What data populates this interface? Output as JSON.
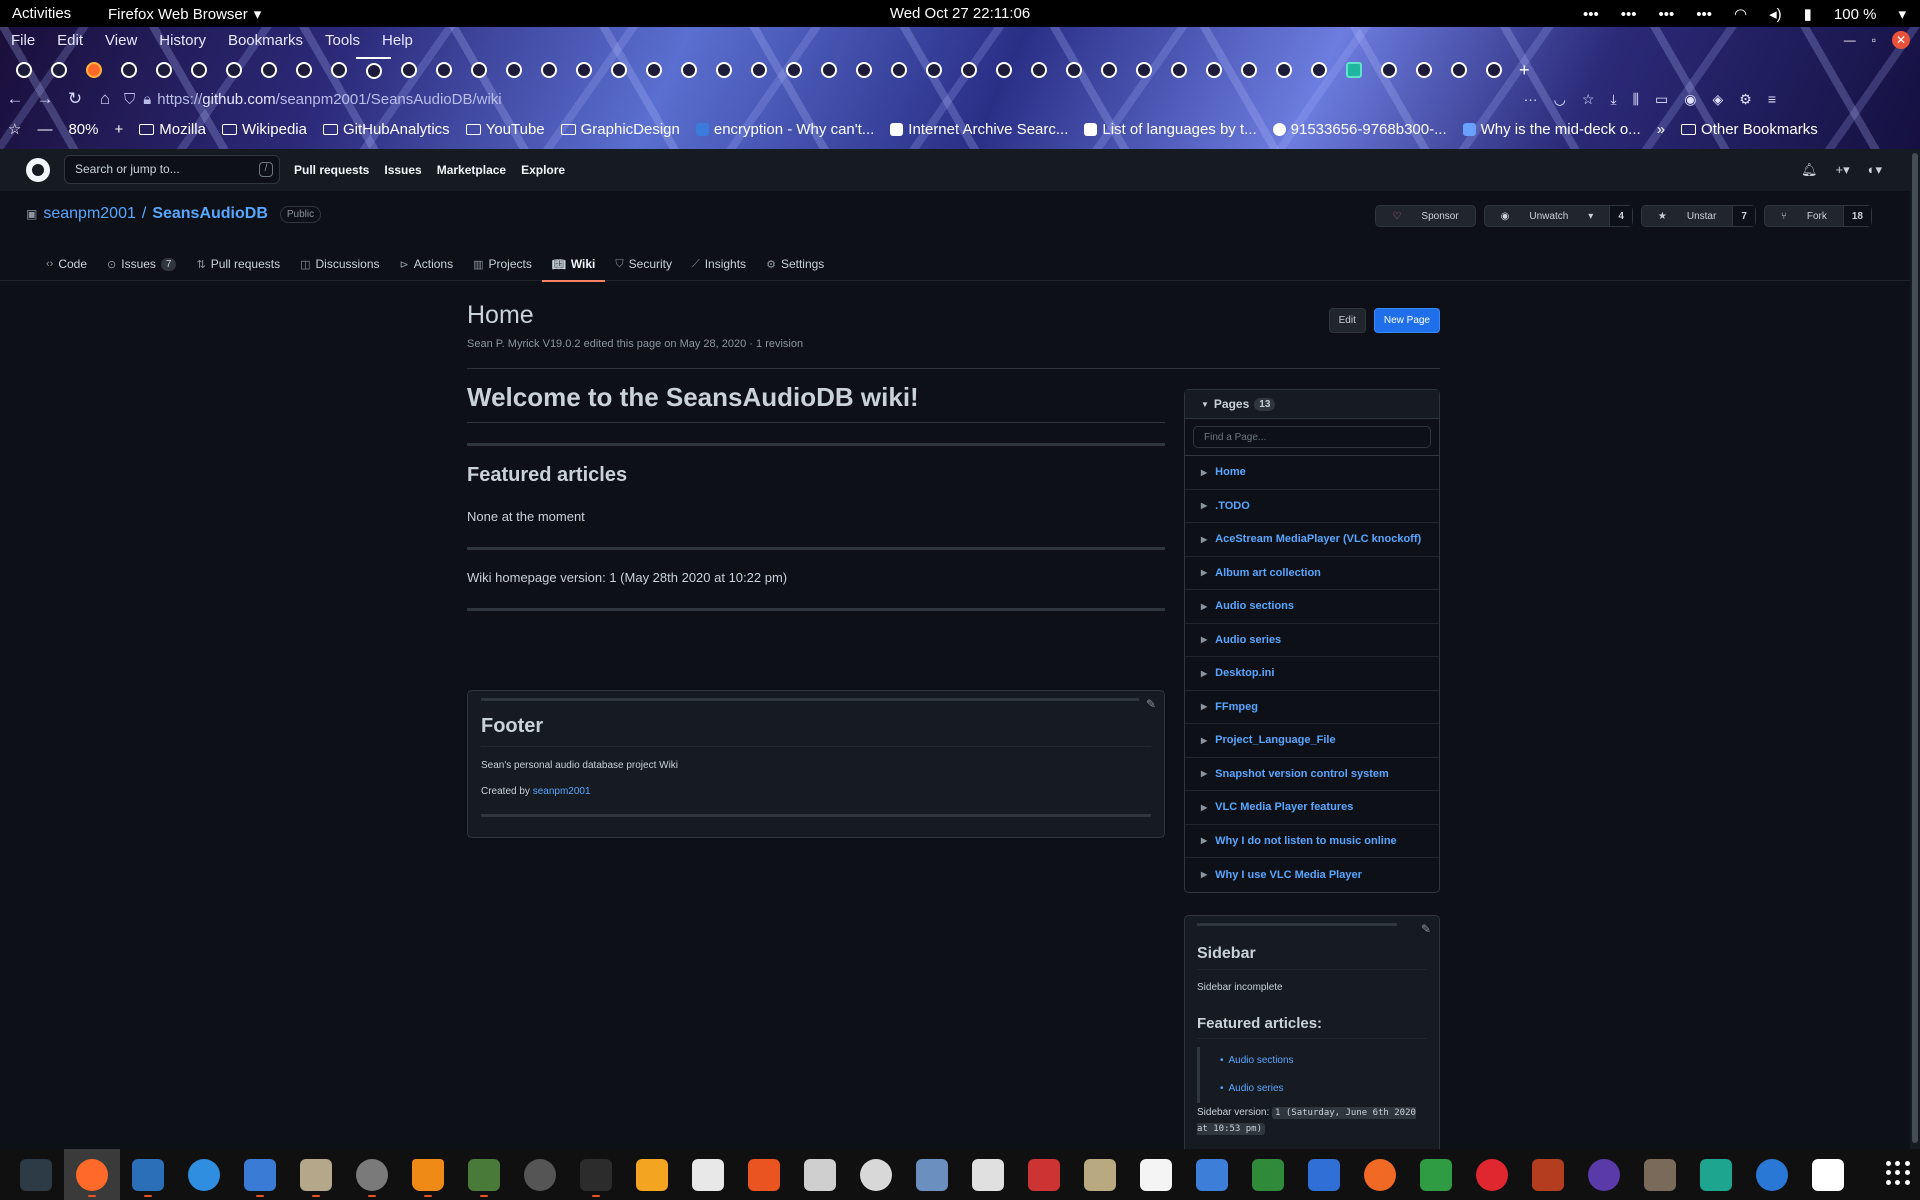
{
  "system": {
    "activities": "Activities",
    "app_name": "Firefox Web Browser",
    "clock": "Wed Oct 27  22:11:06",
    "battery": "100 %"
  },
  "firefox": {
    "menu": [
      "File",
      "Edit",
      "View",
      "History",
      "Bookmarks",
      "Tools",
      "Help"
    ],
    "url_prefix": "https://",
    "url_host": "github.com",
    "url_path": "/seanpm2001/SeansAudioDB/wiki",
    "zoom": "80%",
    "bookmarks": [
      "Mozilla",
      "Wikipedia",
      "GitHubAnalytics",
      "YouTube",
      "GraphicDesign",
      "encryption - Why can't...",
      "Internet Archive Searc...",
      "List of languages by t...",
      "91533656-9768b300-...",
      "Why is the mid-deck o..."
    ],
    "other_bookmarks": "Other Bookmarks"
  },
  "github": {
    "search_placeholder": "Search or jump to...",
    "search_key": "/",
    "header_links": [
      "Pull requests",
      "Issues",
      "Marketplace",
      "Explore"
    ],
    "owner": "seanpm2001",
    "separator": "/",
    "repo": "SeansAudioDB",
    "visibility": "Public",
    "sponsor": "Sponsor",
    "unwatch": "Unwatch",
    "watch_count": "4",
    "unstar": "Unstar",
    "star_count": "7",
    "fork": "Fork",
    "fork_count": "18",
    "tabs": {
      "code": "Code",
      "issues": "Issues",
      "issues_count": "7",
      "pulls": "Pull requests",
      "discussions": "Discussions",
      "actions": "Actions",
      "projects": "Projects",
      "wiki": "Wiki",
      "security": "Security",
      "insights": "Insights",
      "settings": "Settings"
    }
  },
  "wiki": {
    "title": "Home",
    "meta": "Sean P. Myrick V19.0.2 edited this page on May 28, 2020 · 1 revision",
    "edit": "Edit",
    "new_page": "New Page",
    "h1": "Welcome to the SeansAudioDB wiki!",
    "featured_heading": "Featured articles",
    "featured_body": "None at the moment",
    "version_line": "Wiki homepage version: 1 (May 28th 2020 at 10:22 pm)",
    "footer": {
      "title": "Footer",
      "line1": "Sean's personal audio database project Wiki",
      "created_by": "Created by",
      "author": "seanpm2001"
    },
    "pages_label": "Pages",
    "pages_count": "13",
    "find_placeholder": "Find a Page...",
    "pages": [
      "Home",
      ".TODO",
      "AceStream MediaPlayer (VLC knockoff)",
      "Album art collection",
      "Audio sections",
      "Audio series",
      "Desktop.ini",
      "FFmpeg",
      "Project_Language_File",
      "Snapshot version control system",
      "VLC Media Player features",
      "Why I do not listen to music online",
      "Why I use VLC Media Player"
    ],
    "sidebar": {
      "title": "Sidebar",
      "text": "Sidebar incomplete",
      "featured": "Featured articles:",
      "links": [
        "Audio sections",
        "Audio series"
      ],
      "version_label": "Sidebar version:",
      "version_code": "1 (Saturday, June 6th 2020 at 10:53 pm)"
    }
  },
  "colors": {
    "accent": "#58a6ff",
    "primary_button": "#1f6feb",
    "tab_underline": "#f78166"
  }
}
